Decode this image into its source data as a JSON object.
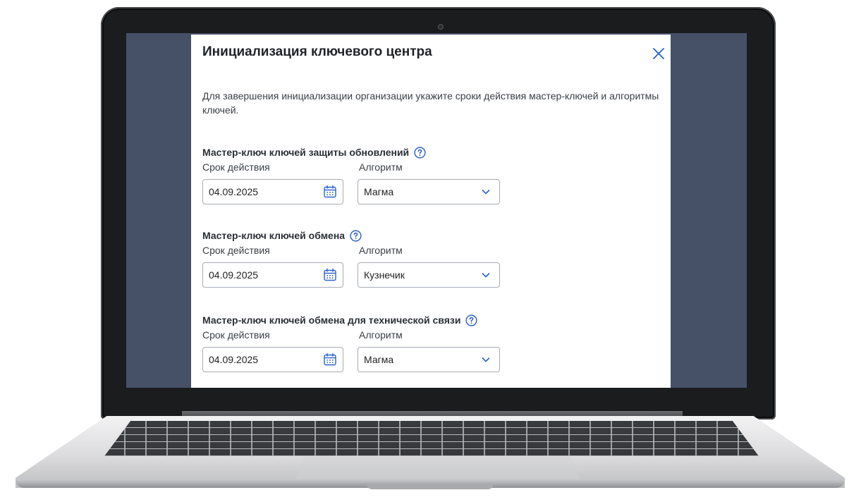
{
  "dialog": {
    "title": "Инициализация ключевого центра",
    "intro": "Для завершения инициализации организации укажите сроки действия мастер-ключей и алгоритмы ключей."
  },
  "sections": [
    {
      "title": "Мастер-ключ ключей защиты обновлений",
      "date_label": "Срок действия",
      "algo_label": "Алгоритм",
      "date_value": "04.09.2025",
      "algo_value": "Магма"
    },
    {
      "title": "Мастер-ключ ключей обмена",
      "date_label": "Срок действия",
      "algo_label": "Алгоритм",
      "date_value": "04.09.2025",
      "algo_value": "Кузнечик"
    },
    {
      "title": "Мастер-ключ ключей обмена для технической связи",
      "date_label": "Срок действия",
      "algo_label": "Алгоритм",
      "date_value": "04.09.2025",
      "algo_value": "Магма"
    }
  ],
  "icons": {
    "close": "close-icon",
    "help": "help-circle-icon",
    "calendar": "calendar-icon",
    "dropdown": "chevron-down-icon"
  },
  "colors": {
    "accent": "#2962c9",
    "screen_background": "#465167",
    "modal_background": "#ffffff"
  }
}
